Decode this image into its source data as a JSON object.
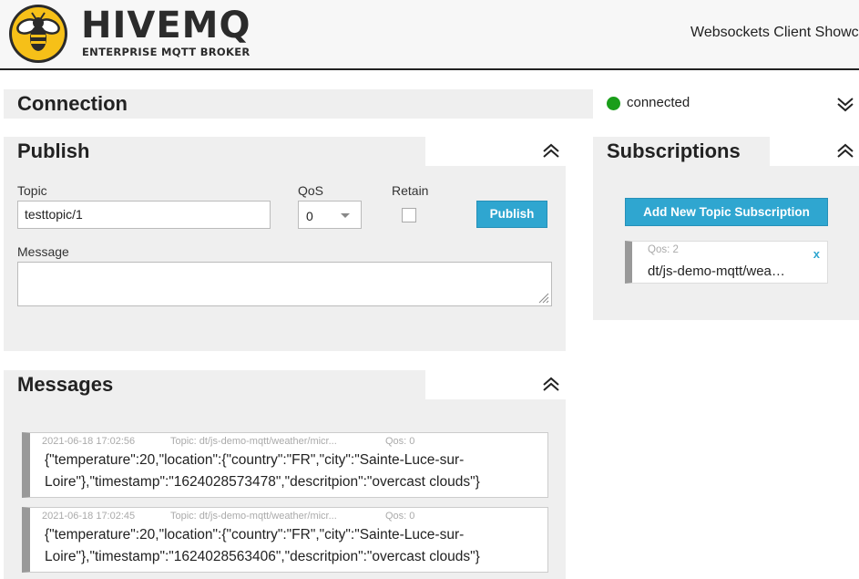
{
  "header": {
    "brand": "HIVEMQ",
    "brand_sub": "ENTERPRISE MQTT BROKER",
    "title": "Websockets Client Showc"
  },
  "connection": {
    "title": "Connection",
    "status": "connected",
    "status_color": "#1a9e1a"
  },
  "publish": {
    "title": "Publish",
    "topic_label": "Topic",
    "topic_value": "testtopic/1",
    "qos_label": "QoS",
    "qos_value": "0",
    "retain_label": "Retain",
    "button_label": "Publish",
    "message_label": "Message",
    "message_value": ""
  },
  "subscriptions": {
    "title": "Subscriptions",
    "add_button": "Add New Topic Subscription",
    "items": [
      {
        "qos": "Qos: 2",
        "topic": "dt/js-demo-mqtt/wea…",
        "close": "x"
      }
    ]
  },
  "messages": {
    "title": "Messages",
    "items": [
      {
        "time": "2021-06-18 17:02:56",
        "topic": "Topic: dt/js-demo-mqtt/weather/micr...",
        "qos": "Qos: 0",
        "body": "{\"temperature\":20,\"location\":{\"country\":\"FR\",\"city\":\"Sainte-Luce-sur-Loire\"},\"timestamp\":\"1624028573478\",\"descritpion\":\"overcast clouds\"}"
      },
      {
        "time": "2021-06-18 17:02:45",
        "topic": "Topic: dt/js-demo-mqtt/weather/micr...",
        "qos": "Qos: 0",
        "body": "{\"temperature\":20,\"location\":{\"country\":\"FR\",\"city\":\"Sainte-Luce-sur-Loire\"},\"timestamp\":\"1624028563406\",\"descritpion\":\"overcast clouds\"}"
      }
    ]
  },
  "colors": {
    "accent": "#2fa6d0",
    "panel_bg": "#efefef",
    "logo_yellow": "#f6c018"
  }
}
